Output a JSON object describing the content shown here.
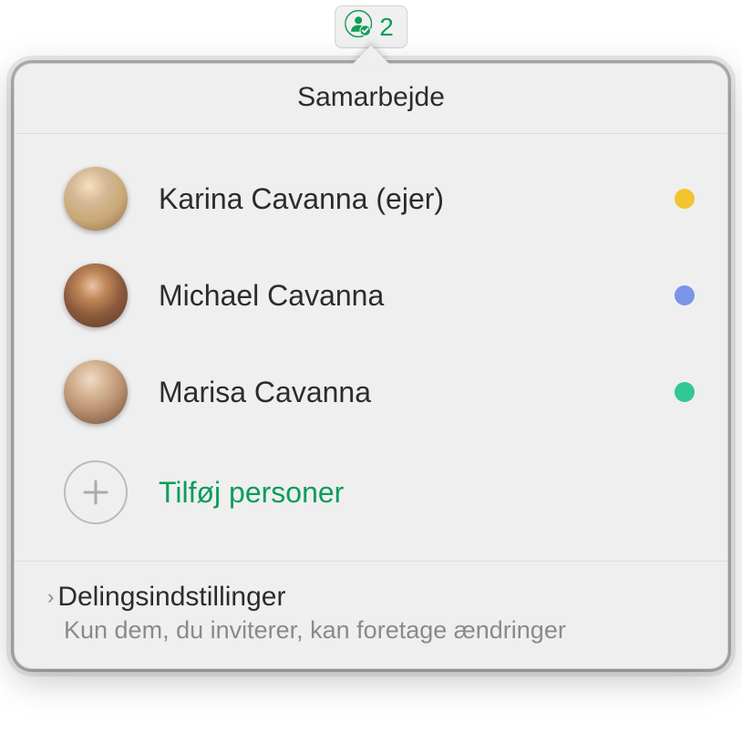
{
  "trigger": {
    "count": "2"
  },
  "popover": {
    "title": "Samarbejde",
    "participants": [
      {
        "name": "Karina Cavanna (ejer)",
        "dot_color": "#f2c52f"
      },
      {
        "name": "Michael Cavanna",
        "dot_color": "#7a94e8"
      },
      {
        "name": "Marisa Cavanna",
        "dot_color": "#31c797"
      }
    ],
    "add_label": "Tilføj personer",
    "settings": {
      "title": "Delingsindstillinger",
      "subtitle": "Kun dem, du inviterer, kan foretage ændringer"
    }
  }
}
